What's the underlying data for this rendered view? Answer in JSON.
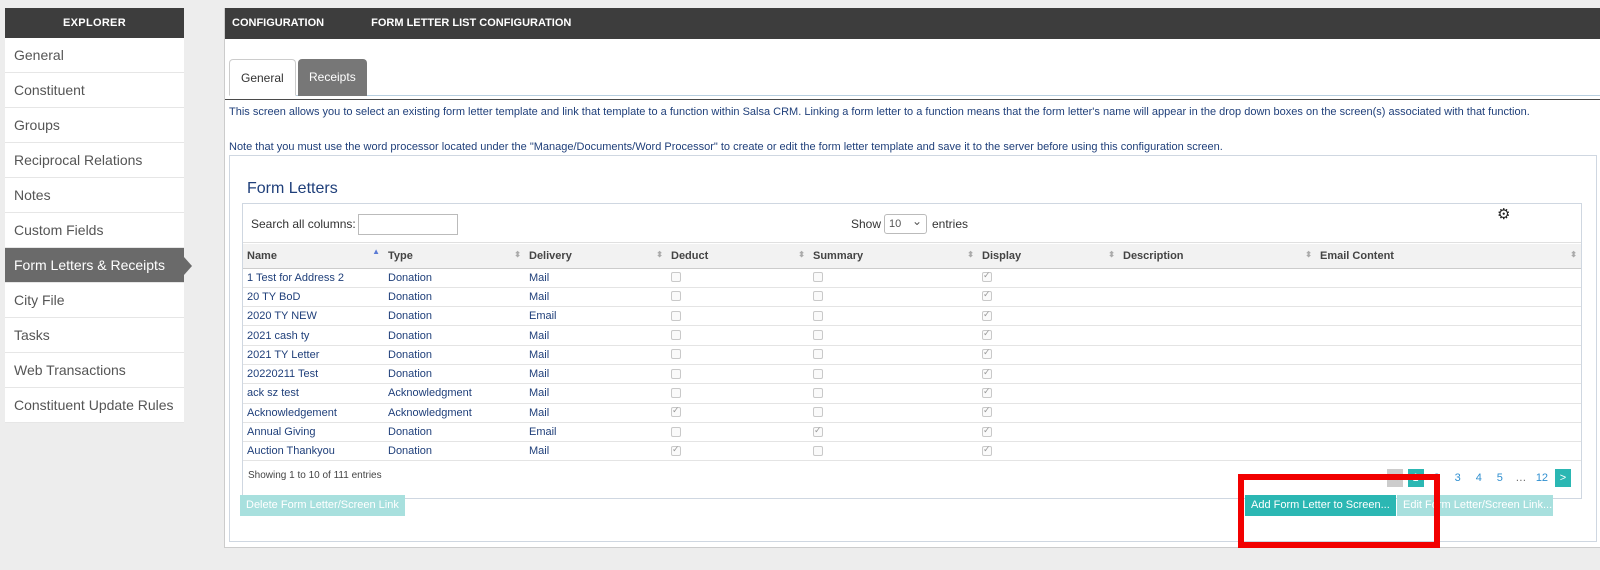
{
  "sidebar": {
    "header": "EXPLORER",
    "items": [
      {
        "label": "General"
      },
      {
        "label": "Constituent"
      },
      {
        "label": "Groups"
      },
      {
        "label": "Reciprocal Relations"
      },
      {
        "label": "Notes"
      },
      {
        "label": "Custom Fields"
      },
      {
        "label": "Form Letters & Receipts"
      },
      {
        "label": "City File"
      },
      {
        "label": "Tasks"
      },
      {
        "label": "Web Transactions"
      },
      {
        "label": "Constituent Update Rules"
      }
    ],
    "active_item": "Form Letters & Receipts"
  },
  "topbar": {
    "left": "CONFIGURATION",
    "right": "FORM LETTER LIST CONFIGURATION"
  },
  "tabs": [
    {
      "label": "General"
    },
    {
      "label": "Receipts"
    }
  ],
  "active_tab": "General",
  "description": {
    "line1": "This screen allows you to select an existing form letter template and link that template to a function within Salsa CRM. Linking a form letter to a function means that the form letter's name will appear in the drop down boxes on the screen(s) associated with that function.",
    "line2": "Note that you must use the word processor located under the \"Manage/Documents/Word Processor\" to create or edit the form letter template and save it to the server before using this configuration screen."
  },
  "form_letters": {
    "title": "Form Letters",
    "search_label": "Search all columns:",
    "search_value": "",
    "show_label": "Show",
    "show_value": "10",
    "entries_label": "entries",
    "columns": [
      "Name",
      "Type",
      "Delivery",
      "Deduct",
      "Summary",
      "Display",
      "Description",
      "Email Content"
    ],
    "sorted_column": "Name",
    "rows": [
      {
        "name": "1 Test for Address 2",
        "type": "Donation",
        "delivery": "Mail",
        "deduct": false,
        "summary": false,
        "display": true,
        "description": "",
        "email_content": ""
      },
      {
        "name": "20 TY BoD",
        "type": "Donation",
        "delivery": "Mail",
        "deduct": false,
        "summary": false,
        "display": true,
        "description": "",
        "email_content": ""
      },
      {
        "name": "2020 TY NEW",
        "type": "Donation",
        "delivery": "Email",
        "deduct": false,
        "summary": false,
        "display": true,
        "description": "",
        "email_content": ""
      },
      {
        "name": "2021 cash ty",
        "type": "Donation",
        "delivery": "Mail",
        "deduct": false,
        "summary": false,
        "display": true,
        "description": "",
        "email_content": ""
      },
      {
        "name": "2021 TY Letter",
        "type": "Donation",
        "delivery": "Mail",
        "deduct": false,
        "summary": false,
        "display": true,
        "description": "",
        "email_content": ""
      },
      {
        "name": "20220211 Test",
        "type": "Donation",
        "delivery": "Mail",
        "deduct": false,
        "summary": false,
        "display": true,
        "description": "",
        "email_content": ""
      },
      {
        "name": "ack sz test",
        "type": "Acknowledgment",
        "delivery": "Mail",
        "deduct": false,
        "summary": false,
        "display": true,
        "description": "",
        "email_content": ""
      },
      {
        "name": "Acknowledgement",
        "type": "Acknowledgment",
        "delivery": "Mail",
        "deduct": true,
        "summary": false,
        "display": true,
        "description": "",
        "email_content": ""
      },
      {
        "name": "Annual Giving",
        "type": "Donation",
        "delivery": "Email",
        "deduct": false,
        "summary": true,
        "display": true,
        "description": "",
        "email_content": ""
      },
      {
        "name": "Auction Thankyou",
        "type": "Donation",
        "delivery": "Mail",
        "deduct": true,
        "summary": false,
        "display": true,
        "description": "",
        "email_content": ""
      }
    ],
    "showing_text": "Showing 1 to 10 of 111 entries",
    "pagination": {
      "prev": "<",
      "pages": [
        "1",
        "2",
        "3",
        "4",
        "5",
        "…",
        "12"
      ],
      "current": "1",
      "next": ">"
    }
  },
  "buttons": {
    "delete": "Delete Form Letter/Screen Link",
    "add": "Add Form Letter to Screen...",
    "edit": "Edit Form Letter/Screen Link..."
  },
  "colors": {
    "accent": "#2bb7b3",
    "highlight": "#f20000",
    "dark_bar": "#3d3d3d",
    "link_text": "#1f3f7a"
  }
}
